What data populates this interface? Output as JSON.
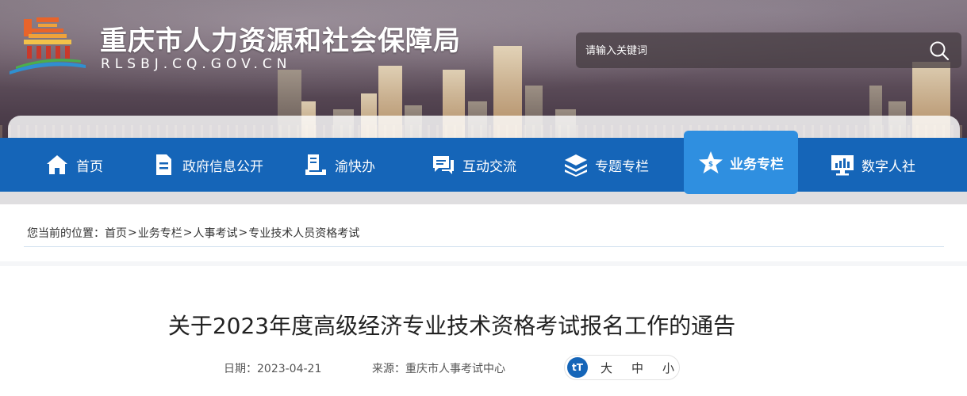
{
  "site": {
    "title": "重庆市人力资源和社会保障局",
    "domain": "RLSBJ.CQ.GOV.CN"
  },
  "search": {
    "placeholder": "请输入关键词"
  },
  "nav": {
    "items": [
      {
        "label": "首页",
        "icon": "home-icon"
      },
      {
        "label": "政府信息公开",
        "icon": "document-icon"
      },
      {
        "label": "渝快办",
        "icon": "book-icon"
      },
      {
        "label": "互动交流",
        "icon": "chat-icon"
      },
      {
        "label": "专题专栏",
        "icon": "layers-icon"
      },
      {
        "label": "业务专栏",
        "icon": "star-icon",
        "active": true
      },
      {
        "label": "数字人社",
        "icon": "monitor-chart-icon"
      }
    ]
  },
  "breadcrumb": {
    "prefix": "您当前的位置：",
    "items": [
      "首页",
      "业务专栏",
      "人事考试",
      "专业技术人员资格考试"
    ],
    "separator": ">"
  },
  "article": {
    "title": "关于2023年度高级经济专业技术资格考试报名工作的通告",
    "date": "日期：2023-04-21",
    "source": "来源：重庆市人事考试中心"
  },
  "font_size": {
    "icon_label": "tT",
    "options": [
      "大",
      "中",
      "小"
    ]
  },
  "colors": {
    "nav_bg": "#1565b8",
    "nav_active": "#2f8fe0"
  }
}
